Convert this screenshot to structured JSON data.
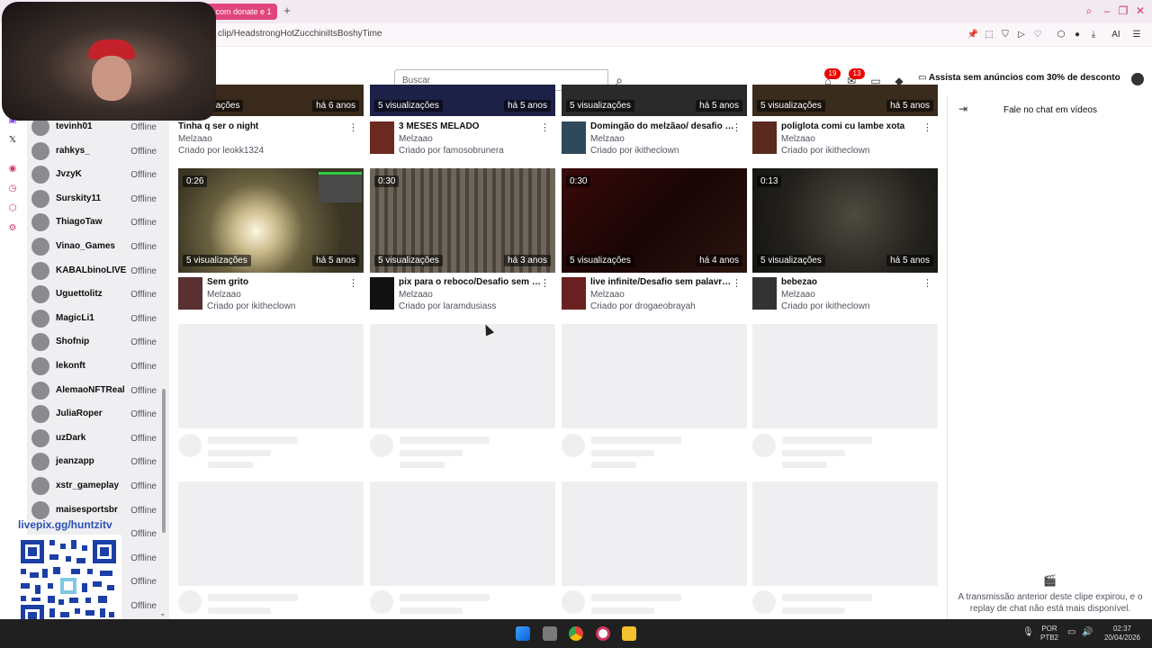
{
  "browser": {
    "tab_title": "a com donate e 1",
    "new_tab": "+",
    "url": "clip/HeadstrongHotZucchiniItsBoshyTime",
    "ai_label": "AI"
  },
  "header": {
    "search_placeholder": "Buscar",
    "badge_1": "19",
    "badge_2": "13",
    "adfree": "Assista sem anúncios com 30% de desconto"
  },
  "sidebar": {
    "channels": [
      {
        "name": "tevinh01",
        "status": "Offline"
      },
      {
        "name": "rahkys_",
        "status": "Offline"
      },
      {
        "name": "JvzyK",
        "status": "Offline"
      },
      {
        "name": "Surskity11",
        "status": "Offline"
      },
      {
        "name": "ThiagoTaw",
        "status": "Offline"
      },
      {
        "name": "Vinao_Games",
        "status": "Offline"
      },
      {
        "name": "KABALbinoLIVE",
        "status": "Offline"
      },
      {
        "name": "Uguettolitz",
        "status": "Offline"
      },
      {
        "name": "MagicLi1",
        "status": "Offline"
      },
      {
        "name": "Shofnip",
        "status": "Offline"
      },
      {
        "name": "lekonft",
        "status": "Offline"
      },
      {
        "name": "AlemaoNFTReal",
        "status": "Offline"
      },
      {
        "name": "JuliaRoper",
        "status": "Offline"
      },
      {
        "name": "uzDark",
        "status": "Offline"
      },
      {
        "name": "jeanzapp",
        "status": "Offline"
      },
      {
        "name": "xstr_gameplay",
        "status": "Offline"
      },
      {
        "name": "maisesportsbr",
        "status": "Offline"
      },
      {
        "name": "",
        "status": "Offline"
      },
      {
        "name": "",
        "status": "Offline"
      },
      {
        "name": "",
        "status": "Offline"
      },
      {
        "name": "",
        "status": "Offline"
      }
    ]
  },
  "overlay": {
    "livepix": "livepix.gg/huntzitv"
  },
  "clips_row1": [
    {
      "views": "visualizações",
      "ago": "há 6 anos",
      "title": "Tinha q ser o night",
      "channel": "Melzaao",
      "creator": "Criado por leokk1324"
    },
    {
      "views": "5 visualizações",
      "ago": "há 5 anos",
      "title": "3 MESES MELADO",
      "channel": "Melzaao",
      "creator": "Criado por famosobrunera"
    },
    {
      "views": "5 visualizações",
      "ago": "há 5 anos",
      "title": "Domingão do melzãao/ desafio s...",
      "channel": "Melzaao",
      "creator": "Criado por ikitheclown"
    },
    {
      "views": "5 visualizações",
      "ago": "há 5 anos",
      "title": "poliglota comi cu lambe xota",
      "channel": "Melzaao",
      "creator": "Criado por ikitheclown"
    }
  ],
  "clips_row2": [
    {
      "duration": "0:26",
      "views": "5 visualizações",
      "ago": "há 5 anos",
      "title": "Sem grito",
      "channel": "Melzaao",
      "creator": "Criado por ikitheclown"
    },
    {
      "duration": "0:30",
      "views": "5 visualizações",
      "ago": "há 3 anos",
      "title": "pix para o reboco/Desafio sem p...",
      "channel": "Melzaao",
      "creator": "Criado por laramdusiass"
    },
    {
      "duration": "0:30",
      "views": "5 visualizações",
      "ago": "há 4 anos",
      "title": "live infinite/Desafio sem palavroe...",
      "channel": "Melzaao",
      "creator": "Criado por drogaeobrayah"
    },
    {
      "duration": "0:13",
      "views": "5 visualizações",
      "ago": "há 5 anos",
      "title": "bebezao",
      "channel": "Melzaao",
      "creator": "Criado por ikitheclown"
    }
  ],
  "chat": {
    "title": "Fale no chat em vídeos",
    "message": "A transmissão anterior deste clipe expirou, e o replay de chat não está mais disponível."
  },
  "taskbar": {
    "lang": "POR",
    "layout": "PTB2",
    "time": "02:37",
    "date": "20/04/2026"
  }
}
